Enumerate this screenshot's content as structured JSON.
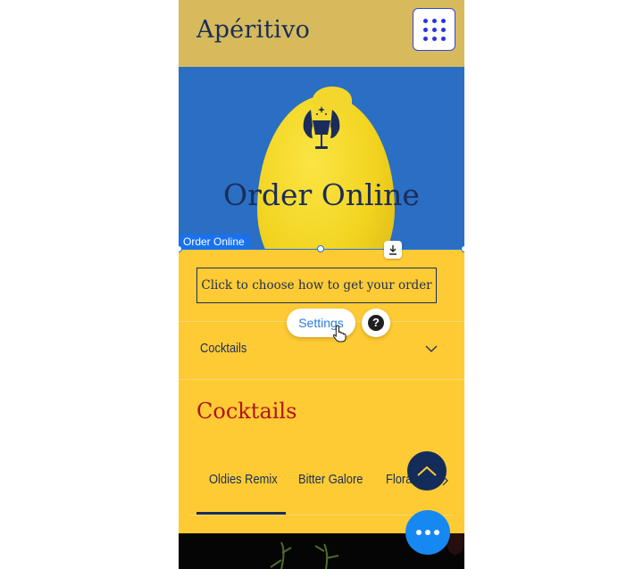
{
  "header": {
    "logo_text": "Apéritivo",
    "menu_icon": "grid-menu-icon"
  },
  "hero": {
    "title": "Order Online",
    "emblem_icon": "winged-goblet-icon"
  },
  "editor": {
    "selection_label": "Order Online",
    "download_icon": "download-icon",
    "settings_label": "Settings",
    "help_label": "?",
    "accent_color": "#1872f0"
  },
  "order": {
    "choose_button_label": "Click to choose how to get your order"
  },
  "menu_dropdown": {
    "selected": "Cocktails"
  },
  "section": {
    "title": "Cocktails",
    "tabs": [
      {
        "label": "Oldies Remix",
        "active": true
      },
      {
        "label": "Bitter Galore",
        "active": false
      },
      {
        "label": "Floral",
        "active": false
      }
    ]
  },
  "floating": {
    "scroll_top_icon": "chevron-up-icon",
    "chat_icon": "more-dots-icon"
  },
  "colors": {
    "header_bg": "#d6ba5c",
    "hero_bg": "#2a6fc4",
    "content_bg": "#fecb34",
    "text_navy": "#1a2d5a",
    "section_title_red": "#b0141a"
  }
}
